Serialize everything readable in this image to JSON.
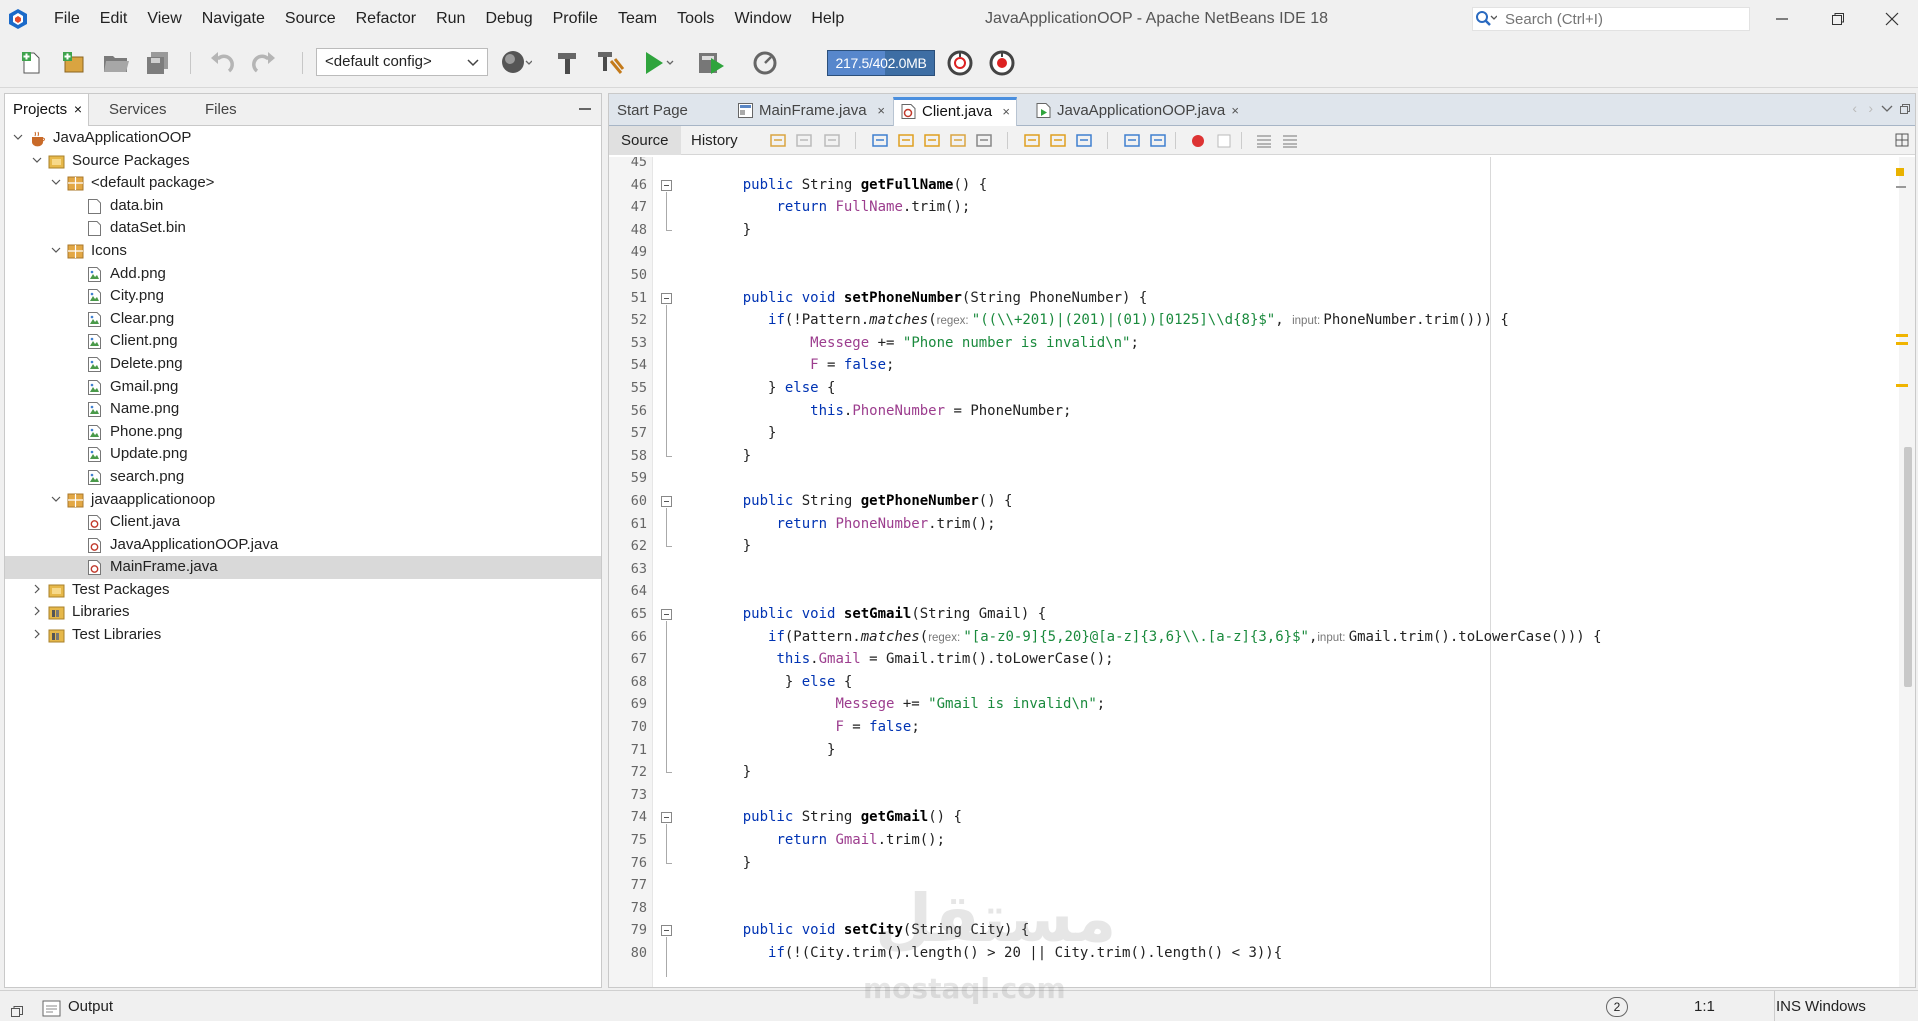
{
  "window": {
    "title": "JavaApplicationOOP - Apache NetBeans IDE 18"
  },
  "menu": [
    "File",
    "Edit",
    "View",
    "Navigate",
    "Source",
    "Refactor",
    "Run",
    "Debug",
    "Profile",
    "Team",
    "Tools",
    "Window",
    "Help"
  ],
  "search": {
    "placeholder": "Search (Ctrl+I)"
  },
  "toolbar": {
    "config": "<default config>",
    "memory_label": "217.5/402.0MB",
    "memory_used_fraction": 0.541
  },
  "left_panel": {
    "tabs": [
      "Projects",
      "Services",
      "Files"
    ],
    "active_tab": "Projects",
    "tree": [
      {
        "label": "JavaApplicationOOP",
        "depth": 0,
        "expanded": true,
        "icon": "project-icon"
      },
      {
        "label": "Source Packages",
        "depth": 1,
        "expanded": true,
        "icon": "folder-icon"
      },
      {
        "label": "<default package>",
        "depth": 2,
        "expanded": true,
        "icon": "package-icon"
      },
      {
        "label": "data.bin",
        "depth": 3,
        "icon": "file-icon"
      },
      {
        "label": "dataSet.bin",
        "depth": 3,
        "icon": "file-icon"
      },
      {
        "label": "Icons",
        "depth": 2,
        "expanded": true,
        "icon": "package-icon"
      },
      {
        "label": "Add.png",
        "depth": 3,
        "icon": "image-file-icon"
      },
      {
        "label": "City.png",
        "depth": 3,
        "icon": "image-file-icon"
      },
      {
        "label": "Clear.png",
        "depth": 3,
        "icon": "image-file-icon"
      },
      {
        "label": "Client.png",
        "depth": 3,
        "icon": "image-file-icon"
      },
      {
        "label": "Delete.png",
        "depth": 3,
        "icon": "image-file-icon"
      },
      {
        "label": "Gmail.png",
        "depth": 3,
        "icon": "image-file-icon"
      },
      {
        "label": "Name.png",
        "depth": 3,
        "icon": "image-file-icon"
      },
      {
        "label": "Phone.png",
        "depth": 3,
        "icon": "image-file-icon"
      },
      {
        "label": "Update.png",
        "depth": 3,
        "icon": "image-file-icon"
      },
      {
        "label": "search.png",
        "depth": 3,
        "icon": "image-file-icon"
      },
      {
        "label": "javaapplicationoop",
        "depth": 2,
        "expanded": true,
        "icon": "package-icon"
      },
      {
        "label": "Client.java",
        "depth": 3,
        "icon": "java-file-icon"
      },
      {
        "label": "JavaApplicationOOP.java",
        "depth": 3,
        "icon": "java-file-icon"
      },
      {
        "label": "MainFrame.java",
        "depth": 3,
        "icon": "java-file-icon",
        "selected": true
      },
      {
        "label": "Test Packages",
        "depth": 1,
        "expanded": false,
        "icon": "folder-icon"
      },
      {
        "label": "Libraries",
        "depth": 1,
        "expanded": false,
        "icon": "library-icon"
      },
      {
        "label": "Test Libraries",
        "depth": 1,
        "expanded": false,
        "icon": "library-icon"
      }
    ]
  },
  "editor": {
    "tabs": [
      {
        "label": "Start Page",
        "closable": false
      },
      {
        "label": "MainFrame.java",
        "closable": true
      },
      {
        "label": "Client.java",
        "closable": true,
        "active": true
      },
      {
        "label": "JavaApplicationOOP.java",
        "closable": true
      }
    ],
    "subtabs": [
      "Source",
      "History"
    ],
    "close_glyph": "×",
    "lines": [
      {
        "n": "45",
        "t": []
      },
      {
        "n": "46",
        "fold": true,
        "t": [
          [
            "    "
          ],
          [
            "public ",
            "kw"
          ],
          [
            "String "
          ],
          [
            "getFullName",
            "mt"
          ],
          [
            "() {"
          ]
        ]
      },
      {
        "n": "47",
        "t": [
          [
            "        "
          ],
          [
            "return ",
            "kw"
          ],
          [
            "FullName",
            "fl"
          ],
          [
            ".trim();"
          ]
        ]
      },
      {
        "n": "48",
        "t": [
          [
            "    }"
          ]
        ]
      },
      {
        "n": "49",
        "t": []
      },
      {
        "n": "50",
        "t": []
      },
      {
        "n": "51",
        "fold": true,
        "t": [
          [
            "    "
          ],
          [
            "public ",
            "kw"
          ],
          [
            "void ",
            "kw"
          ],
          [
            "setPhoneNumber",
            "mt"
          ],
          [
            "(String PhoneNumber) {"
          ]
        ]
      },
      {
        "n": "52",
        "t": [
          [
            "       "
          ],
          [
            "if",
            "kw"
          ],
          [
            "(!Pattern."
          ],
          [
            "matches",
            "it"
          ],
          [
            "("
          ],
          [
            "regex: ",
            "hint"
          ],
          [
            "\"((\\\\+201)|(201)|(01))[0125]\\\\d{8}$\"",
            "st"
          ],
          [
            ", "
          ],
          [
            "input: ",
            "hint"
          ],
          [
            "PhoneNumber.trim())) {"
          ]
        ]
      },
      {
        "n": "53",
        "t": [
          [
            "            "
          ],
          [
            "Messege",
            "fl"
          ],
          [
            " += "
          ],
          [
            "\"Phone number is invalid\\n\"",
            "st"
          ],
          [
            ";"
          ]
        ]
      },
      {
        "n": "54",
        "t": [
          [
            "            "
          ],
          [
            "F",
            "fl"
          ],
          [
            " = "
          ],
          [
            "false",
            "kw"
          ],
          [
            ";"
          ]
        ]
      },
      {
        "n": "55",
        "t": [
          [
            "       } "
          ],
          [
            "else ",
            "kw"
          ],
          [
            "{"
          ]
        ]
      },
      {
        "n": "56",
        "t": [
          [
            "            "
          ],
          [
            "this",
            "kw"
          ],
          [
            "."
          ],
          [
            "PhoneNumber",
            "fl"
          ],
          [
            " = PhoneNumber;"
          ]
        ]
      },
      {
        "n": "57",
        "t": [
          [
            "       }"
          ]
        ]
      },
      {
        "n": "58",
        "t": [
          [
            "    }"
          ]
        ]
      },
      {
        "n": "59",
        "t": []
      },
      {
        "n": "60",
        "fold": true,
        "t": [
          [
            "    "
          ],
          [
            "public ",
            "kw"
          ],
          [
            "String "
          ],
          [
            "getPhoneNumber",
            "mt"
          ],
          [
            "() {"
          ]
        ]
      },
      {
        "n": "61",
        "t": [
          [
            "        "
          ],
          [
            "return ",
            "kw"
          ],
          [
            "PhoneNumber",
            "fl"
          ],
          [
            ".trim();"
          ]
        ]
      },
      {
        "n": "62",
        "t": [
          [
            "    }"
          ]
        ]
      },
      {
        "n": "63",
        "t": []
      },
      {
        "n": "64",
        "t": []
      },
      {
        "n": "65",
        "fold": true,
        "t": [
          [
            "    "
          ],
          [
            "public ",
            "kw"
          ],
          [
            "void ",
            "kw"
          ],
          [
            "setGmail",
            "mt"
          ],
          [
            "(String Gmail) {"
          ]
        ]
      },
      {
        "n": "66",
        "t": [
          [
            "       "
          ],
          [
            "if",
            "kw"
          ],
          [
            "(Pattern."
          ],
          [
            "matches",
            "it"
          ],
          [
            "("
          ],
          [
            "regex: ",
            "hint"
          ],
          [
            "\"[a-z0-9]{5,20}@[a-z]{3,6}\\\\.[a-z]{3,6}$\"",
            "st"
          ],
          [
            ","
          ],
          [
            "input: ",
            "hint"
          ],
          [
            "Gmail.trim().toLowerCase())) {"
          ]
        ]
      },
      {
        "n": "67",
        "t": [
          [
            "        "
          ],
          [
            "this",
            "kw"
          ],
          [
            "."
          ],
          [
            "Gmail",
            "fl"
          ],
          [
            " = Gmail.trim().toLowerCase();"
          ]
        ]
      },
      {
        "n": "68",
        "t": [
          [
            "         } "
          ],
          [
            "else ",
            "kw"
          ],
          [
            "{"
          ]
        ]
      },
      {
        "n": "69",
        "t": [
          [
            "               "
          ],
          [
            "Messege",
            "fl"
          ],
          [
            " += "
          ],
          [
            "\"Gmail is invalid\\n\"",
            "st"
          ],
          [
            ";"
          ]
        ]
      },
      {
        "n": "70",
        "t": [
          [
            "               "
          ],
          [
            "F",
            "fl"
          ],
          [
            " = "
          ],
          [
            "false",
            "kw"
          ],
          [
            ";"
          ]
        ]
      },
      {
        "n": "71",
        "t": [
          [
            "              }"
          ]
        ]
      },
      {
        "n": "72",
        "t": [
          [
            "    }"
          ]
        ]
      },
      {
        "n": "73",
        "t": []
      },
      {
        "n": "74",
        "fold": true,
        "t": [
          [
            "    "
          ],
          [
            "public ",
            "kw"
          ],
          [
            "String "
          ],
          [
            "getGmail",
            "mt"
          ],
          [
            "() {"
          ]
        ]
      },
      {
        "n": "75",
        "t": [
          [
            "        "
          ],
          [
            "return ",
            "kw"
          ],
          [
            "Gmail",
            "fl"
          ],
          [
            ".trim();"
          ]
        ]
      },
      {
        "n": "76",
        "t": [
          [
            "    }"
          ]
        ]
      },
      {
        "n": "77",
        "t": []
      },
      {
        "n": "78",
        "t": []
      },
      {
        "n": "79",
        "fold": true,
        "t": [
          [
            "    "
          ],
          [
            "public ",
            "kw"
          ],
          [
            "void ",
            "kw"
          ],
          [
            "setCity",
            "mt"
          ],
          [
            "(String City) {"
          ]
        ]
      },
      {
        "n": "80",
        "t": [
          [
            "       "
          ],
          [
            "if",
            "kw"
          ],
          [
            "(!(City.trim().length() > 20 || City.trim().length() < 3)){"
          ]
        ]
      }
    ]
  },
  "statusbar": {
    "output_label": "Output",
    "notifications": "2",
    "position": "1:1",
    "insert_mode": "INS",
    "line_endings": "Windows (CRLF)"
  },
  "watermark": {
    "line1": "مستقل",
    "line2": "mostaql.com"
  }
}
